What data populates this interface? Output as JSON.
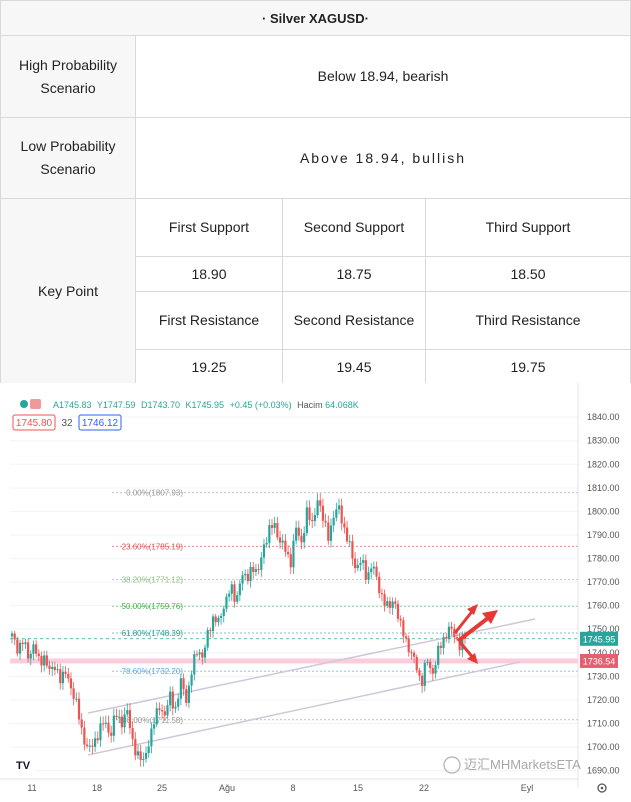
{
  "table": {
    "title": "· Silver XAGUSD·",
    "high_label": "High Probability Scenario",
    "high_value": "Below 18.94, bearish",
    "low_label": "Low Probability Scenario",
    "low_value": "Above  18.94,  bullish",
    "key_label": "Key Point",
    "support_headers": [
      "First Support",
      "Second Support",
      "Third Support"
    ],
    "support_values": [
      "18.90",
      "18.75",
      "18.50"
    ],
    "resistance_headers": [
      "First Resistance",
      "Second Resistance",
      "Third Resistance"
    ],
    "resistance_values": [
      "19.25",
      "19.45",
      "19.75"
    ]
  },
  "chart_data": {
    "type": "candlestick",
    "ohlc_text": {
      "o": "A1745.83",
      "h": "Y1747.59",
      "l": "D1743.70",
      "c": "K1745.95",
      "chg": "+0.45 (+0.03%)",
      "vol_label": "Hacim",
      "vol": "64.068K"
    },
    "bid": "1745.80",
    "spread": "32",
    "ask": "1746.12",
    "yticks": [
      "1690.00",
      "1700.00",
      "1710.00",
      "1720.00",
      "1730.00",
      "1740.00",
      "1750.00",
      "1760.00",
      "1770.00",
      "1780.00",
      "1790.00",
      "1800.00",
      "1810.00",
      "1820.00",
      "1830.00",
      "1840.00"
    ],
    "ylim": [
      1689,
      1846
    ],
    "xticks": [
      "11",
      "18",
      "25",
      "Ağu",
      "8",
      "15",
      "22",
      "Eyl"
    ],
    "price_label": "1745.95",
    "price_value": 1745.95,
    "pink_label": "1736.54",
    "pink_value": 1736.54,
    "fib_levels": [
      {
        "label": "0.00%(1807.93)",
        "value": 1807.93,
        "color": "#999999"
      },
      {
        "label": "23.60%(1785.19)",
        "value": 1785.19,
        "color": "#e05555"
      },
      {
        "label": "38.20%(1771.12)",
        "value": 1771.12,
        "color": "#8fbf7f"
      },
      {
        "label": "50.00%(1759.76)",
        "value": 1759.76,
        "color": "#4caf50"
      },
      {
        "label": "61.80%(1748.39)",
        "value": 1748.39,
        "color": "#2e9e8f"
      },
      {
        "label": "78.60%(1732.20)",
        "value": 1732.2,
        "color": "#64a8e0"
      },
      {
        "label": "100.00%(1711.58)",
        "value": 1711.58,
        "color": "#999999"
      }
    ],
    "price_path": [
      1747,
      1742,
      1745,
      1738,
      1744,
      1735,
      1739,
      1731,
      1735,
      1728,
      1732,
      1724,
      1716,
      1705,
      1698,
      1702,
      1707,
      1711,
      1705,
      1714,
      1710,
      1716,
      1703,
      1697,
      1693,
      1702,
      1710,
      1718,
      1713,
      1722,
      1716,
      1728,
      1720,
      1733,
      1742,
      1738,
      1749,
      1756,
      1752,
      1762,
      1768,
      1761,
      1774,
      1770,
      1778,
      1772,
      1785,
      1791,
      1795,
      1788,
      1784,
      1778,
      1793,
      1786,
      1800,
      1794,
      1806,
      1796,
      1790,
      1798,
      1802,
      1791,
      1784,
      1776,
      1779,
      1772,
      1778,
      1769,
      1763,
      1758,
      1764,
      1752,
      1747,
      1740,
      1735,
      1727,
      1737,
      1731,
      1740,
      1745,
      1751,
      1747,
      1744,
      1746
    ]
  },
  "watermark": "迈汇MHMarketsETA",
  "colors": {
    "up": "#26a69a",
    "down": "#ef5350",
    "arrow": "#e53935"
  }
}
